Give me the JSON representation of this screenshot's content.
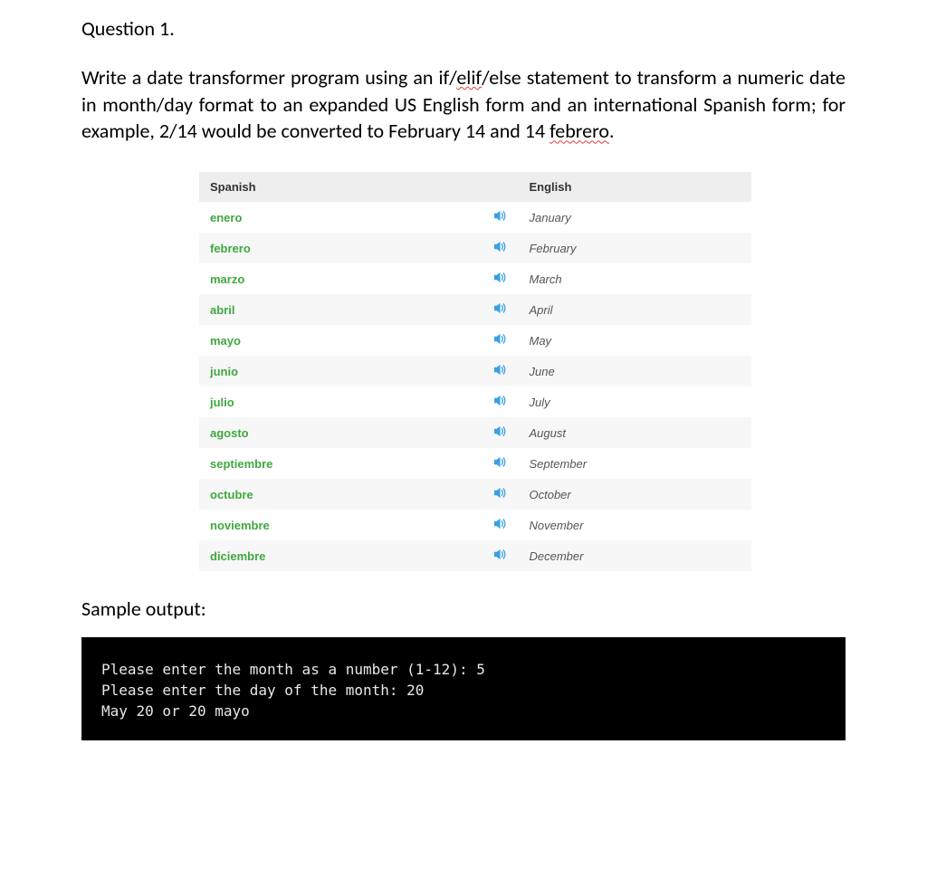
{
  "question": {
    "title": "Question 1.",
    "body_parts": {
      "p1": "Write a date transformer program using an if/",
      "elif": "elif",
      "p2": "/else statement to transform a numeric date in month/day format to an expanded US English form and an international Spanish form; for example, 2/14 would be converted to February 14 and 14 ",
      "febrero": "febrero",
      "p3": "."
    }
  },
  "table": {
    "header_spanish": "Spanish",
    "header_english": "English",
    "rows": [
      {
        "es": "enero",
        "en": "January"
      },
      {
        "es": "febrero",
        "en": "February"
      },
      {
        "es": "marzo",
        "en": "March"
      },
      {
        "es": "abril",
        "en": "April"
      },
      {
        "es": "mayo",
        "en": "May"
      },
      {
        "es": "junio",
        "en": "June"
      },
      {
        "es": "julio",
        "en": "July"
      },
      {
        "es": "agosto",
        "en": "August"
      },
      {
        "es": "septiembre",
        "en": "September"
      },
      {
        "es": "octubre",
        "en": "October"
      },
      {
        "es": "noviembre",
        "en": "November"
      },
      {
        "es": "diciembre",
        "en": "December"
      }
    ]
  },
  "sample": {
    "label": "Sample output:",
    "lines": [
      "Please enter the month as a number (1-12): 5",
      "Please enter the day of the month: 20",
      "May 20 or 20 mayo"
    ]
  },
  "icons": {
    "audio": "speaker-icon"
  },
  "colors": {
    "spanish_text": "#3fa83f",
    "audio_icon": "#39a0e5",
    "terminal_bg": "#000000",
    "terminal_fg": "#e8e8e8",
    "squiggle": "#e23b3b"
  }
}
